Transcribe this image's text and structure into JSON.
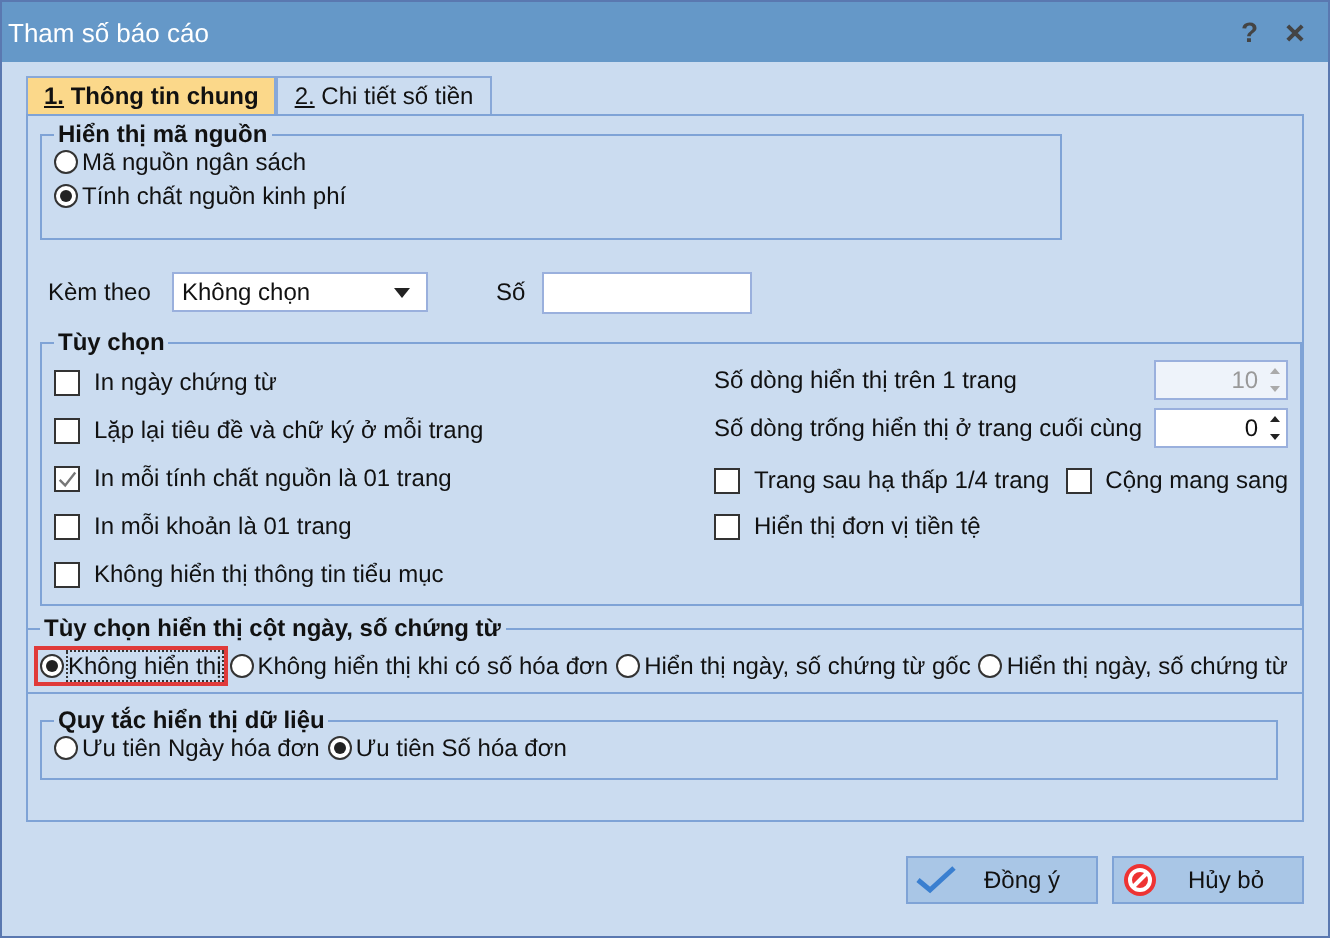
{
  "window": {
    "title": "Tham số báo cáo",
    "help": "?"
  },
  "tabs": [
    {
      "label": "1. Thông tin chung",
      "selected": true
    },
    {
      "label": "2. Chi tiết số tiền",
      "selected": false
    }
  ],
  "source_display": {
    "title": "Hiển thị mã nguồn",
    "options": [
      {
        "label": "Mã nguồn ngân sách",
        "selected": false
      },
      {
        "label": "Tính chất nguồn kinh phí",
        "selected": true
      }
    ]
  },
  "attach": {
    "label": "Kèm theo",
    "value": "Không chọn"
  },
  "number": {
    "label": "Số"
  },
  "options": {
    "title": "Tùy chọn",
    "checks": [
      {
        "label": "In ngày chứng từ",
        "checked": false
      },
      {
        "label": "Lặp lại tiêu đề và chữ ký ở mỗi trang",
        "checked": false
      },
      {
        "label": "In mỗi tính chất nguồn là 01 trang",
        "checked": true
      },
      {
        "label": "In mỗi khoản là 01 trang",
        "checked": false
      },
      {
        "label": "Không hiển thị thông tin tiểu mục",
        "checked": false
      }
    ],
    "spinners": [
      {
        "label": "Số dòng hiển thị trên 1 trang",
        "value": "10",
        "disabled": true
      },
      {
        "label": "Số dòng trống hiển thị ở trang cuối cùng",
        "value": "0",
        "disabled": false
      }
    ],
    "right_checks": [
      {
        "label": "Trang sau hạ thấp 1/4 trang",
        "checked": false
      },
      {
        "label": "Cộng mang sang",
        "checked": false
      },
      {
        "label": "Hiển thị đơn vị tiền tệ",
        "checked": false
      }
    ]
  },
  "date_column": {
    "title": "Tùy chọn hiển thị cột ngày, số chứng từ",
    "options": [
      {
        "label": "Không hiển thị",
        "selected": true,
        "highlighted": true
      },
      {
        "label": "Không hiển thị khi có số hóa đơn",
        "selected": false,
        "highlighted": false
      },
      {
        "label": "Hiển thị ngày, số chứng từ gốc",
        "selected": false,
        "highlighted": false
      },
      {
        "label": "Hiển thị ngày, số chứng từ",
        "selected": false,
        "highlighted": false
      }
    ]
  },
  "data_rule": {
    "title": "Quy tắc hiển thị dữ liệu",
    "options": [
      {
        "label": "Ưu tiên Ngày hóa đơn",
        "selected": false
      },
      {
        "label": "Ưu tiên Số hóa đơn",
        "selected": true
      }
    ]
  },
  "buttons": [
    {
      "label": "Đồng ý",
      "kind": "ok"
    },
    {
      "label": "Hủy bỏ",
      "kind": "cancel"
    }
  ]
}
